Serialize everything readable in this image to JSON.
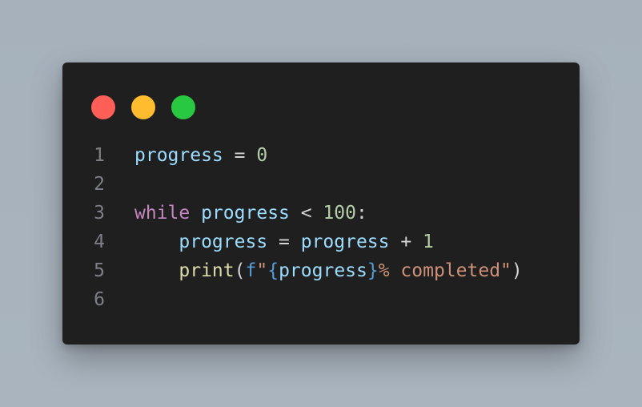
{
  "window": {
    "controls": [
      {
        "name": "close",
        "color": "#ff5f57"
      },
      {
        "name": "minimize",
        "color": "#febc2e"
      },
      {
        "name": "maximize",
        "color": "#28c840"
      }
    ]
  },
  "code": {
    "lines": [
      {
        "number": "1",
        "tokens": [
          {
            "text": "progress",
            "type": "var"
          },
          {
            "text": " = ",
            "type": "op"
          },
          {
            "text": "0",
            "type": "num"
          }
        ]
      },
      {
        "number": "2",
        "tokens": []
      },
      {
        "number": "3",
        "tokens": [
          {
            "text": "while",
            "type": "kw"
          },
          {
            "text": " ",
            "type": "op"
          },
          {
            "text": "progress",
            "type": "var"
          },
          {
            "text": " < ",
            "type": "op"
          },
          {
            "text": "100",
            "type": "num"
          },
          {
            "text": ":",
            "type": "op"
          }
        ]
      },
      {
        "number": "4",
        "tokens": [
          {
            "text": "    ",
            "type": "op"
          },
          {
            "text": "progress",
            "type": "var"
          },
          {
            "text": " = ",
            "type": "op"
          },
          {
            "text": "progress",
            "type": "var"
          },
          {
            "text": " + ",
            "type": "op"
          },
          {
            "text": "1",
            "type": "num"
          }
        ]
      },
      {
        "number": "5",
        "tokens": [
          {
            "text": "    ",
            "type": "op"
          },
          {
            "text": "print",
            "type": "fn"
          },
          {
            "text": "(",
            "type": "punc"
          },
          {
            "text": "f",
            "type": "fprefix"
          },
          {
            "text": "\"",
            "type": "str"
          },
          {
            "text": "{",
            "type": "brace"
          },
          {
            "text": "progress",
            "type": "var"
          },
          {
            "text": "}",
            "type": "brace"
          },
          {
            "text": "% completed\"",
            "type": "str"
          },
          {
            "text": ")",
            "type": "punc"
          }
        ]
      },
      {
        "number": "6",
        "tokens": []
      }
    ]
  }
}
